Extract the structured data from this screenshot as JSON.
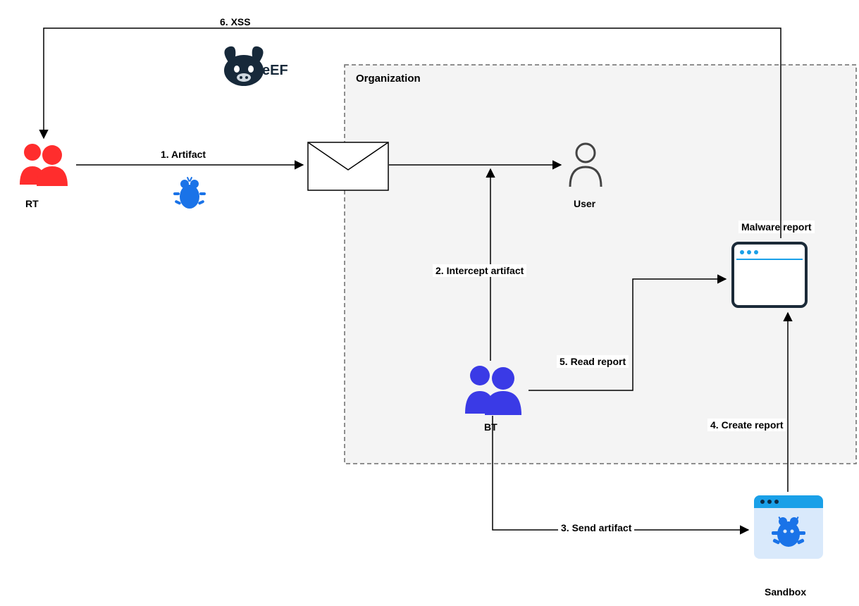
{
  "diagram": {
    "nodes": {
      "rt": {
        "caption": "RT"
      },
      "user": {
        "caption": "User"
      },
      "bt": {
        "caption": "BT"
      },
      "sandbox": {
        "caption": "Sandbox"
      },
      "org": {
        "title": "Organization"
      },
      "malware_report": {
        "label": "Malware report"
      }
    },
    "edges": {
      "artifact": {
        "label": "1. Artifact"
      },
      "intercept": {
        "label": "2. Intercept artifact"
      },
      "send_artifact": {
        "label": "3. Send artifact"
      },
      "create_report": {
        "label": "4. Create report"
      },
      "read_report": {
        "label": "5. Read report"
      },
      "xss": {
        "label": "6. XSS"
      }
    },
    "logos": {
      "beef": {
        "name": "BeEF"
      }
    }
  }
}
